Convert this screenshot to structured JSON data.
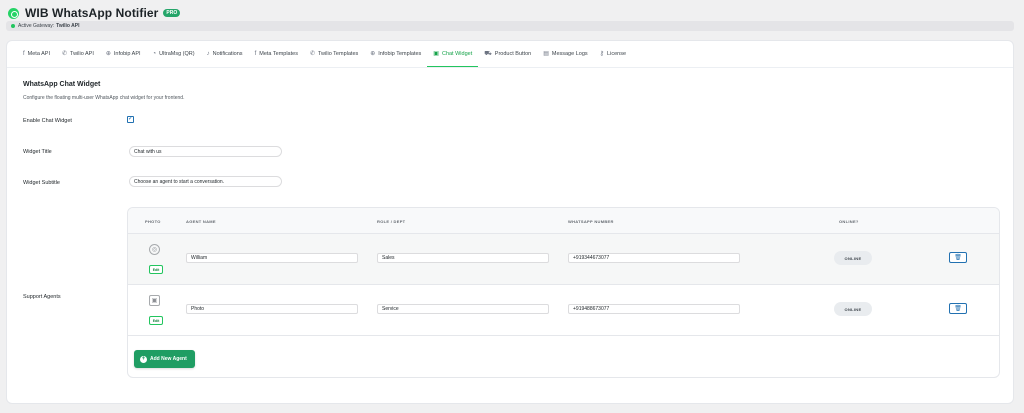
{
  "header": {
    "title": "WIB WhatsApp Notifier",
    "badge": "PRO"
  },
  "gateway": {
    "label": "Active Gateway:",
    "value": "Twilio API"
  },
  "tabs": [
    {
      "label": "Meta API",
      "icon": "facebook-icon",
      "glyph": "f"
    },
    {
      "label": "Twilio API",
      "icon": "phone-icon",
      "glyph": "✆"
    },
    {
      "label": "Infobip API",
      "icon": "globe-icon",
      "glyph": "⊕"
    },
    {
      "label": "UltraMsg (QR)",
      "icon": "whatsapp-icon",
      "glyph": "◔"
    },
    {
      "label": "Notifications",
      "icon": "bell-icon",
      "glyph": "♪"
    },
    {
      "label": "Meta Templates",
      "icon": "facebook-icon",
      "glyph": "f"
    },
    {
      "label": "Twilio Templates",
      "icon": "phone-icon",
      "glyph": "✆"
    },
    {
      "label": "Infobip Templates",
      "icon": "globe-icon",
      "glyph": "⊕"
    },
    {
      "label": "Chat Widget",
      "icon": "chat-icon",
      "glyph": "▣"
    },
    {
      "label": "Product Button",
      "icon": "cart-icon",
      "glyph": "⛟"
    },
    {
      "label": "Message Logs",
      "icon": "list-icon",
      "glyph": "▤"
    },
    {
      "label": "License",
      "icon": "key-icon",
      "glyph": "⚷"
    }
  ],
  "active_tab": "Chat Widget",
  "section": {
    "title": "WhatsApp Chat Widget",
    "description": "Configure the floating multi-user WhatsApp chat widget for your frontend."
  },
  "fields": {
    "enable_label": "Enable Chat Widget",
    "enable_checked": true,
    "check_glyph": "✓",
    "title_label": "Widget Title",
    "title_value": "Chat with us",
    "subtitle_label": "Widget Subtitle",
    "subtitle_value": "Choose an agent to start a conversation.",
    "agents_label": "Support Agents"
  },
  "agents_table": {
    "columns": [
      "PHOTO",
      "AGENT NAME",
      "ROLE / DEPT",
      "WHATSAPP NUMBER",
      "ONLINE?"
    ],
    "rows": [
      {
        "name": "William",
        "role": "Sales",
        "number": "+919344673077",
        "online": "ONLINE",
        "edit": "Edit",
        "photo_icon": "user-avatar-icon"
      },
      {
        "name": "Photo",
        "role": "Service",
        "number": "+919488673077",
        "online": "ONLINE",
        "edit": "Edit",
        "photo_icon": "image-placeholder-icon"
      }
    ],
    "add_button": "Add New Agent"
  },
  "colors": {
    "accent": "#22c55e",
    "brand_green": "#1f9d63",
    "link_blue": "#2271b1"
  }
}
